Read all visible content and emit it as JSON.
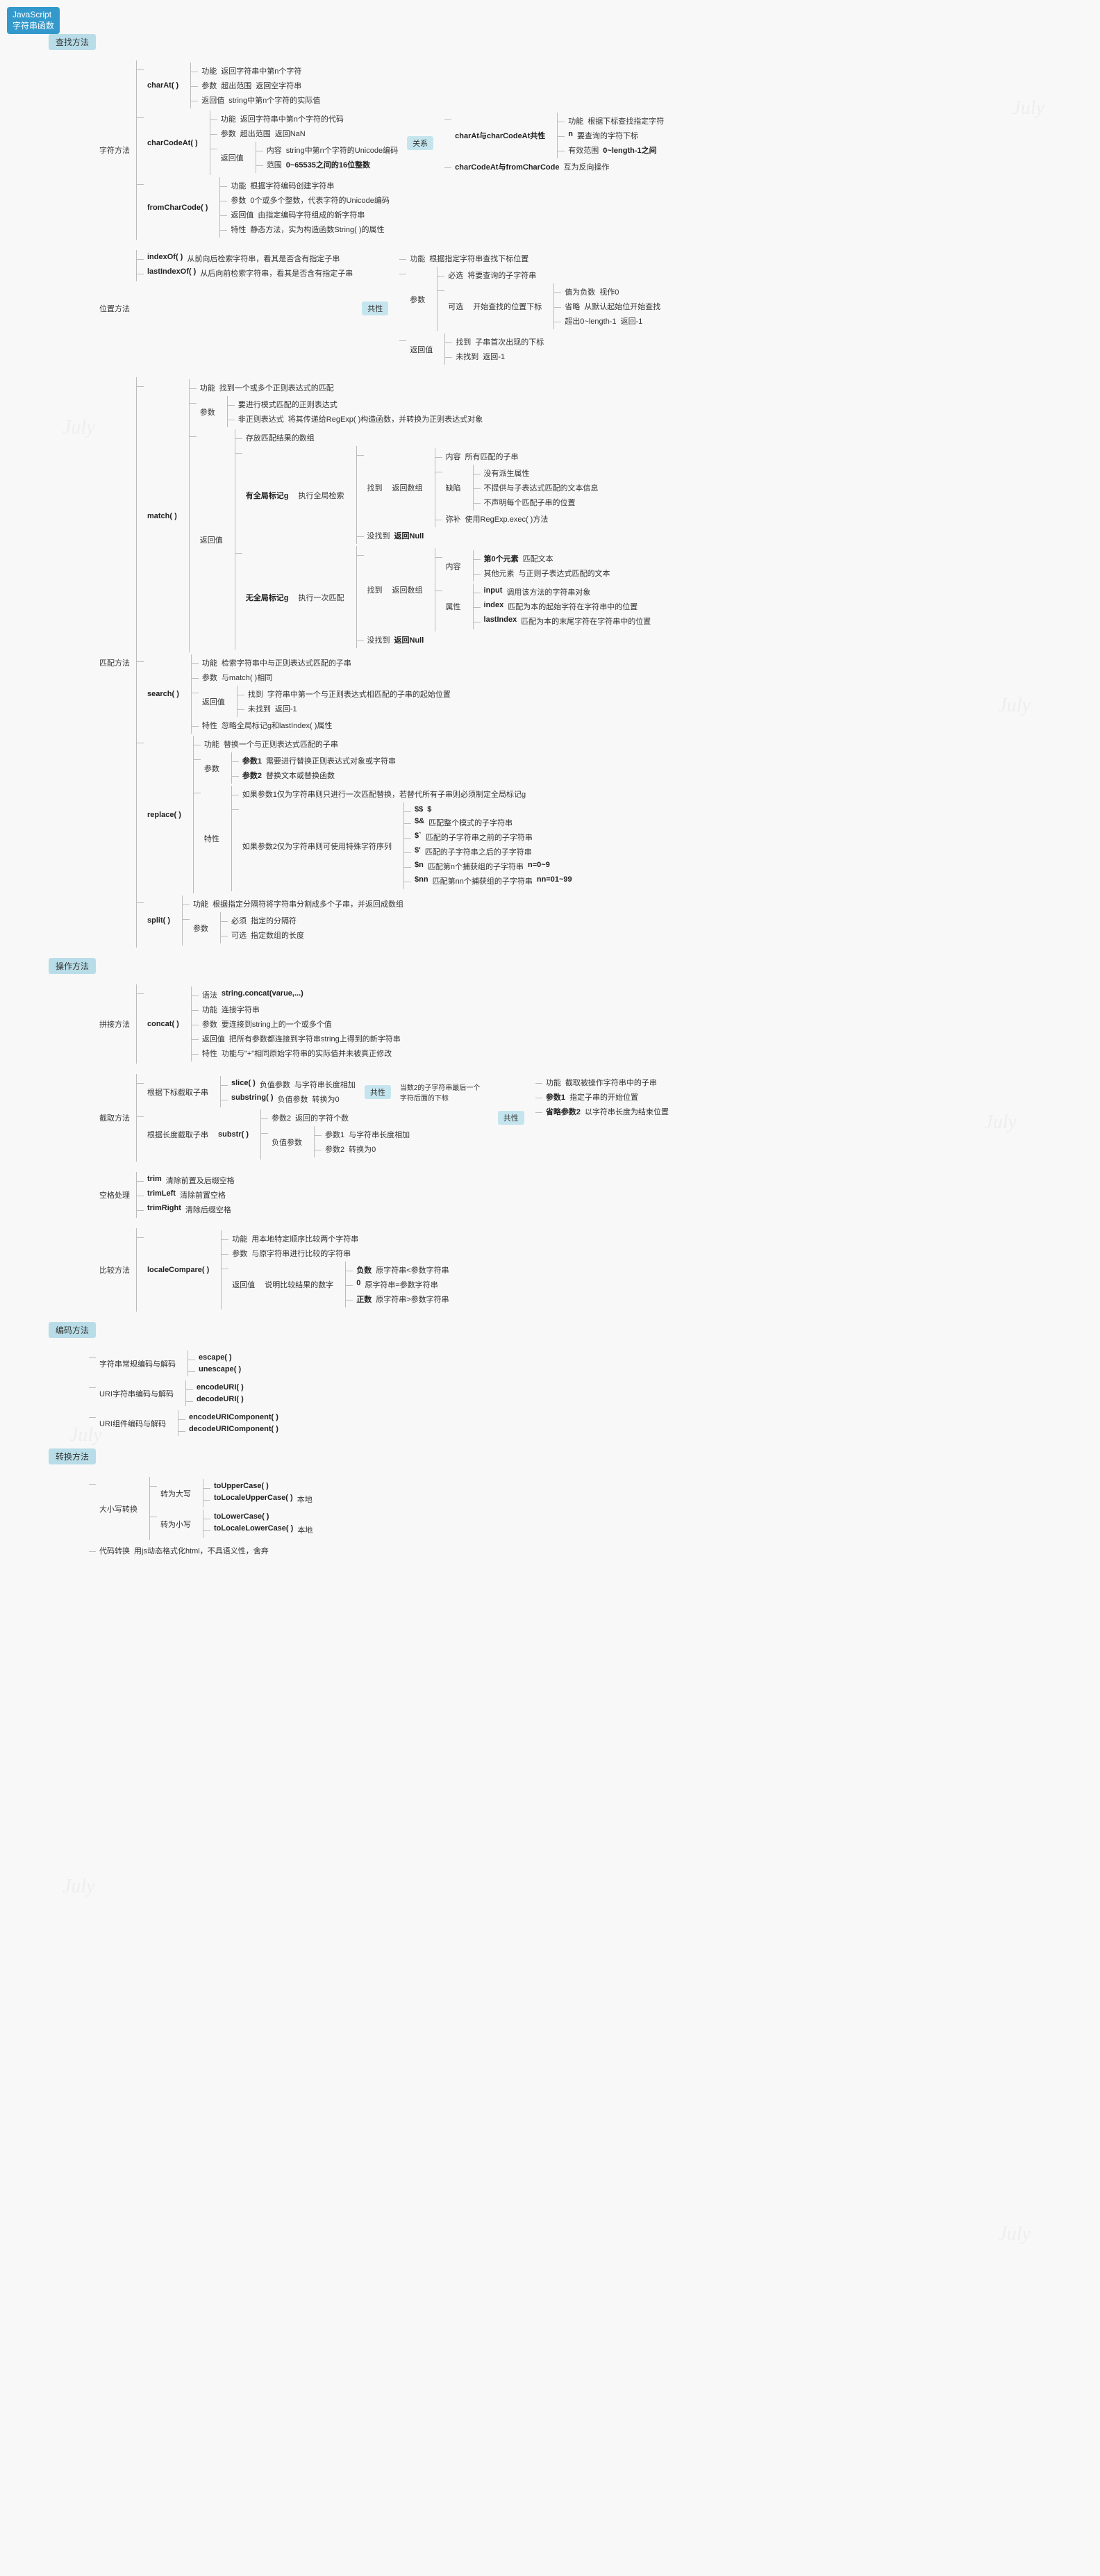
{
  "root": {
    "line1": "JavaScript",
    "line2": "字符串函数"
  },
  "sections": {
    "search": "查找方法",
    "op": "操作方法",
    "encode": "编码方法",
    "convert": "转换方法"
  },
  "charFunc": {
    "group": "字符方法",
    "charAt": {
      "name": "charAt( )",
      "func": "功能",
      "funcDesc": "返回字符串中第n个字符",
      "param": "参数",
      "paramOver": "超出范围",
      "paramOverDesc": "返回空字符串",
      "ret": "返回值",
      "retDesc": "string中第n个字符的实际值"
    },
    "charCodeAt": {
      "name": "charCodeAt( )",
      "func": "功能",
      "funcDesc": "返回字符串中第n个字符的代码",
      "param": "参数",
      "paramOver": "超出范围",
      "paramOverDesc": "返回NaN",
      "ret": "返回值",
      "retCont": "内容",
      "retContDesc": "string中第n个字符的Unicode编码",
      "retRange": "范围",
      "retRangeDesc": "0~65535之间的16位整数"
    },
    "fromCharCode": {
      "name": "fromCharCode( )",
      "func": "功能",
      "funcDesc": "根据字符编码创建字符串",
      "param": "参数",
      "paramDesc": "0个或多个整数，代表字符的Unicode编码",
      "ret": "返回值",
      "retDesc": "由指定编码字符组成的新字符串",
      "spec": "特性",
      "specDesc": "静态方法，实为构造函数String( )的属性"
    },
    "relation": {
      "label": "关系",
      "r1name": "charAt与charCodeAt共性",
      "r1func": "功能",
      "r1funcDesc": "根据下标查找指定字符",
      "r1n": "n",
      "r1nDesc": "要查询的字符下标",
      "r1range": "有效范围",
      "r1rangeDesc": "0~length-1之间",
      "r2name": "charCodeAt与fromCharCode",
      "r2desc": "互为反向操作"
    }
  },
  "posFunc": {
    "group": "位置方法",
    "indexOf": {
      "name": "indexOf( )",
      "desc": "从前向后检索字符串，看其是否含有指定子串"
    },
    "lastIndexOf": {
      "name": "lastIndexOf( )",
      "desc": "从后向前检索字符串，看其是否含有指定子串"
    },
    "common": {
      "label": "共性",
      "func": "功能",
      "funcDesc": "根据指定字符串查找下标位置",
      "param": "参数",
      "req": "必选",
      "reqDesc": "将要查询的子字符串",
      "opt": "可选",
      "optLabel": "开始查找的位置下标",
      "optNeg": "值为负数",
      "optNegDesc": "视作0",
      "optOmit": "省略",
      "optOmitDesc": "从默认起始位开始查找",
      "optOver": "超出0~length-1",
      "optOverDesc": "返回-1",
      "ret": "返回值",
      "found": "找到",
      "foundDesc": "子串首次出现的下标",
      "notFound": "未找到",
      "notFoundDesc": "返回-1"
    }
  },
  "matchFunc": {
    "group": "匹配方法",
    "match": {
      "name": "match( )",
      "func": "功能",
      "funcDesc": "找到一个或多个正则表达式的匹配",
      "param": "参数",
      "paramReq": "要进行模式匹配的正则表达式",
      "paramNon": "非正则表达式",
      "paramNonDesc": "将其传递给RegExp( )构造函数，并转换为正则表达式对象",
      "ret": "返回值",
      "retDesc": "存放匹配结果的数组",
      "globalG": "有全局标记g",
      "globalDesc": "执行全局检索",
      "noGlobalG": "无全局标记g",
      "noGlobalDesc": "执行一次匹配",
      "found": "找到",
      "retArr": "返回数组",
      "notFound": "没找到",
      "retNull": "返回Null",
      "gCont": "内容",
      "gContDesc": "所有匹配的子串",
      "gMiss": "缺陷",
      "gMiss1": "没有派生属性",
      "gMiss2": "不提供与子表达式匹配的文本信息",
      "gMiss3": "不声明每个匹配子串的位置",
      "gFix": "弥补",
      "gFixDesc": "使用RegExp.exec( )方法",
      "ngCont": "内容",
      "ngE0": "第0个元素",
      "ngE0Desc": "匹配文本",
      "ngEn": "其他元素",
      "ngEnDesc": "与正则子表达式匹配的文本",
      "ngAttr": "属性",
      "ngInput": "input",
      "ngInputDesc": "调用该方法的字符串对象",
      "ngIndex": "index",
      "ngIndexDesc": "匹配为本的起始字符在字符串中的位置",
      "ngLast": "lastIndex",
      "ngLastDesc": "匹配为本的末尾字符在字符串中的位置"
    },
    "search": {
      "name": "search( )",
      "func": "功能",
      "funcDesc": "检索字符串中与正则表达式匹配的子串",
      "param": "参数",
      "paramDesc": "与match( )相同",
      "ret": "返回值",
      "found": "找到",
      "foundDesc": "字符串中第一个与正则表达式相匹配的子串的起始位置",
      "notFound": "未找到",
      "notFoundDesc": "返回-1",
      "spec": "特性",
      "specDesc": "忽略全局标记g和lastIndex( )属性"
    },
    "replace": {
      "name": "replace( )",
      "func": "功能",
      "funcDesc": "替换一个与正则表达式匹配的子串",
      "param": "参数",
      "p1": "参数1",
      "p1desc": "需要进行替换正则表达式对象或字符串",
      "p2": "参数2",
      "p2desc": "替换文本或替换函数",
      "spec": "特性",
      "s1": "如果参数1仅为字符串则只进行一次匹配替换，若替代所有子串则必须制定全局标记g",
      "s2": "如果参数2仅为字符串则可使用特殊字符序列",
      "dd": "$$",
      "ddDesc": "$",
      "da": "$&",
      "daDesc": "匹配整个模式的子字符串",
      "db": "$`",
      "dbDesc": "匹配的子字符串之前的子字符串",
      "dq": "$'",
      "dqDesc": "匹配的子字符串之后的子字符串",
      "dn": "$n",
      "dnDesc": "匹配第n个捕获组的子字符串",
      "dnRange": "n=0~9",
      "dnn": "$nn",
      "dnnDesc": "匹配第nn个捕获组的子字符串",
      "dnnRange": "nn=01~99"
    },
    "split": {
      "name": "split( )",
      "func": "功能",
      "funcDesc": "根据指定分隔符将字符串分割成多个子串，并返回成数组",
      "param": "参数",
      "req": "必须",
      "reqDesc": "指定的分隔符",
      "opt": "可选",
      "optDesc": "指定数组的长度"
    }
  },
  "opFunc": {
    "concat": {
      "group": "拼接方法",
      "name": "concat( )",
      "syn": "语法",
      "synDesc": "string.concat(varue,...)",
      "func": "功能",
      "funcDesc": "连接字符串",
      "param": "参数",
      "paramDesc": "要连接到string上的一个或多个值",
      "ret": "返回值",
      "retDesc": "把所有参数都连接到字符串string上得到的新字符串",
      "spec": "特性",
      "specDesc": "功能与\"+\"相同原始字符串的实际值并未被真正修改"
    },
    "extract": {
      "group": "截取方法",
      "bySub": "根据下标截取子串",
      "byLen": "根据长度截取子串",
      "slice": "slice( )",
      "sliceNeg": "负值参数",
      "sliceNegDesc": "与字符串长度相加",
      "substring": "substring( )",
      "subNeg": "负值参数",
      "subNegDesc": "转换为0",
      "substr": "substr( )",
      "p2": "参数2",
      "p2desc": "返回的字符个数",
      "neg": "负值参数",
      "negP1": "参数1",
      "negP1desc": "与字符串长度相加",
      "negP2": "参数2",
      "negP2desc": "转换为0",
      "common1": "共性",
      "common1desc": "当数2的子字符串最后一个字符后面的下标",
      "common2": "共性",
      "c2func": "功能",
      "c2funcDesc": "截取被操作字符串中的子串",
      "c2p1": "参数1",
      "c2p1desc": "指定子串的开始位置",
      "c2p2": "省略参数2",
      "c2p2desc": "以字符串长度为结束位置"
    },
    "space": {
      "group": "空格处理",
      "trim": "trim",
      "trimDesc": "清除前置及后缀空格",
      "trimLeft": "trimLeft",
      "trimLeftDesc": "清除前置空格",
      "trimRight": "trimRight",
      "trimRightDesc": "清除后缀空格"
    },
    "compare": {
      "group": "比较方法",
      "name": "localeCompare( )",
      "func": "功能",
      "funcDesc": "用本地特定顺序比较两个字符串",
      "param": "参数",
      "paramDesc": "与原字符串进行比较的字符串",
      "ret": "返回值",
      "retDesc": "说明比较结果的数字",
      "neg": "负数",
      "negDesc": "原字符串<参数字符串",
      "zero": "0",
      "zeroDesc": "原字符串=参数字符串",
      "pos": "正数",
      "posDesc": "原字符串>参数字符串"
    }
  },
  "encodeFunc": {
    "g1": "字符串常规编码与解码",
    "e1": "escape( )",
    "e2": "unescape( )",
    "g2": "URI字符串编码与解码",
    "e3": "encodeURI( )",
    "e4": "decodeURI( )",
    "g3": "URI组件编码与解码",
    "e5": "encodeURIComponent( )",
    "e6": "decodeURIComponent( )"
  },
  "convertFunc": {
    "g1": "大小写转换",
    "up": "转为大写",
    "u1": "toUpperCase( )",
    "u2": "toLocaleUpperCase( )",
    "u2desc": "本地",
    "low": "转为小写",
    "l1": "toLowerCase( )",
    "l2": "toLocaleLowerCase( )",
    "l2desc": "本地",
    "g2": "代码转换",
    "g2desc": "用js动态格式化html，不具语义性，舍弃"
  }
}
